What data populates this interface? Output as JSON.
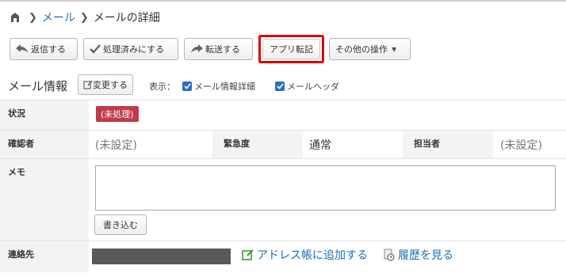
{
  "breadcrumb": {
    "root": "メール",
    "current": "メールの詳細"
  },
  "toolbar": {
    "reply": "返信する",
    "mark_done": "処理済みにする",
    "forward": "転送する",
    "app_transfer": "アプリ転記",
    "other_actions": "その他の操作"
  },
  "info": {
    "title": "メール情報",
    "edit": "変更する",
    "display_label": "表示：",
    "show_detail": "メール情報詳細",
    "show_header": "メールヘッダ"
  },
  "fields": {
    "status_label": "状況",
    "status_value": "(未処理)",
    "confirmer_label": "確認者",
    "confirmer_value": "(未設定)",
    "urgency_label": "緊急度",
    "urgency_value": "通常",
    "assignee_label": "担当者",
    "assignee_value": "(未設定)",
    "memo_label": "メモ",
    "memo_value": "",
    "write_button": "書き込む",
    "contact_label": "連絡先",
    "add_address": "アドレス帳に追加する",
    "view_history": "履歴を見る"
  },
  "colors": {
    "accent_link": "#1b6fb8",
    "status_badge": "#c03a4a",
    "highlight": "#e00000",
    "checkbox": "#2a70c9"
  }
}
